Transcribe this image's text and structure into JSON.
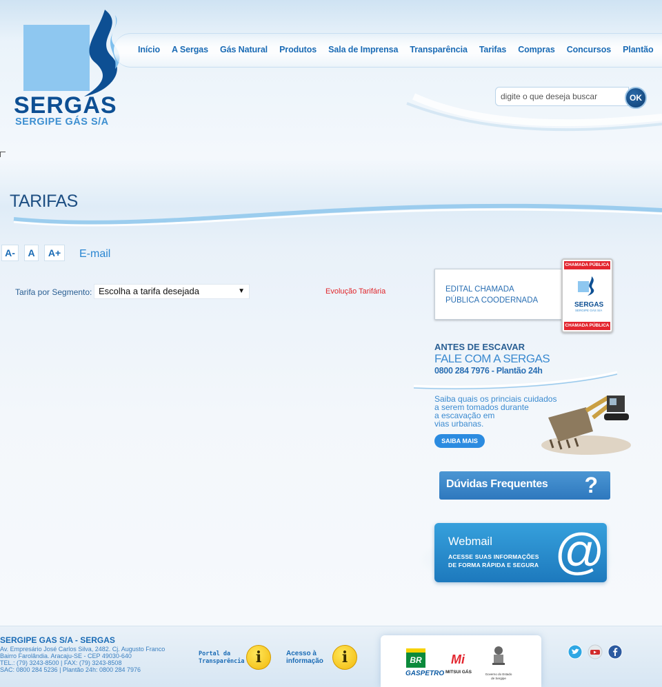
{
  "brand": {
    "name": "SERGAS",
    "subtitle": "SERGIPE GÁS S/A",
    "accent": "#1a6bb5",
    "dark": "#0d4f93",
    "light": "#8ec7f0"
  },
  "nav": {
    "items": [
      "Início",
      "A Sergas",
      "Gás Natural",
      "Produtos",
      "Sala de Imprensa",
      "Transparência",
      "Tarifas",
      "Compras",
      "Concursos",
      "Plantão"
    ]
  },
  "search": {
    "placeholder": "digite o que deseja buscar",
    "button_label": "OK"
  },
  "page": {
    "title": "TARIFAS"
  },
  "font_controls": {
    "decrease": "A-",
    "normal": "A",
    "increase": "A+"
  },
  "email_link": "E-mail",
  "tariff": {
    "label": "Tarifa por Segmento:",
    "selected": "Escolha a tarifa desejada",
    "evolution_link": "Evolução Tarifária"
  },
  "sidebar": {
    "edital": {
      "line1": "EDITAL CHAMADA",
      "line2": "PÚBLICA COODERNADA",
      "badge_top": "CHAMADA PÚBLICA",
      "badge_bottom": "CHAMADA PÚBLICA",
      "badge_name": "SERGAS",
      "badge_sub": "SERGIPE GÁS S/A"
    },
    "escavar": {
      "line1": "ANTES DE ESCAVAR",
      "line2": "FALE COM A SERGAS",
      "line3": "0800 284 7976 - Plantão 24h",
      "text": [
        "Saiba quais os princiais cuidados",
        "a serem tomados durante",
        "a escavação em",
        "vias urbanas."
      ],
      "button": "SAIBA MAIS"
    },
    "duvidas": {
      "label": "Dúvidas Frequentes",
      "icon_glyph": "?"
    },
    "webmail": {
      "title": "Webmail",
      "sub_line1": "ACESSE SUAS INFORMAÇÕES",
      "sub_line2": "DE FORMA RÁPIDA E SEGURA",
      "icon_glyph": "@"
    }
  },
  "footer": {
    "company": "SERGIPE GAS S/A - SERGAS",
    "address_lines": [
      "Av. Empresário José Carlos Silva, 2482. Cj. Augusto Franco",
      "Bairro Farolândia. Aracaju-SE - CEP 49030-640",
      "TEL.: (79) 3243-8500 | FAX: (79) 3243-8508",
      "SAC: 0800 284 5236 | Plantão 24h: 0800 284 7976"
    ],
    "portal": {
      "line1": "Portal da",
      "line2": "Transparência",
      "icon_glyph": "i"
    },
    "acesso": {
      "line1": "Acesso à",
      "line2": "informação",
      "icon_glyph": "i"
    },
    "partners": {
      "petrobras_mark": "BR",
      "gaspetro": "GASPETRO",
      "mitsui_mark": "Mi",
      "mitsui": "MITSUI GÁS",
      "governo": "Governo do Estado de Sergipe"
    },
    "social": [
      {
        "name": "twitter-icon",
        "color": "#2fa7e4"
      },
      {
        "name": "youtube-icon",
        "color": "#cfd6dc"
      },
      {
        "name": "facebook-icon",
        "color": "#2c5aa0"
      }
    ]
  }
}
